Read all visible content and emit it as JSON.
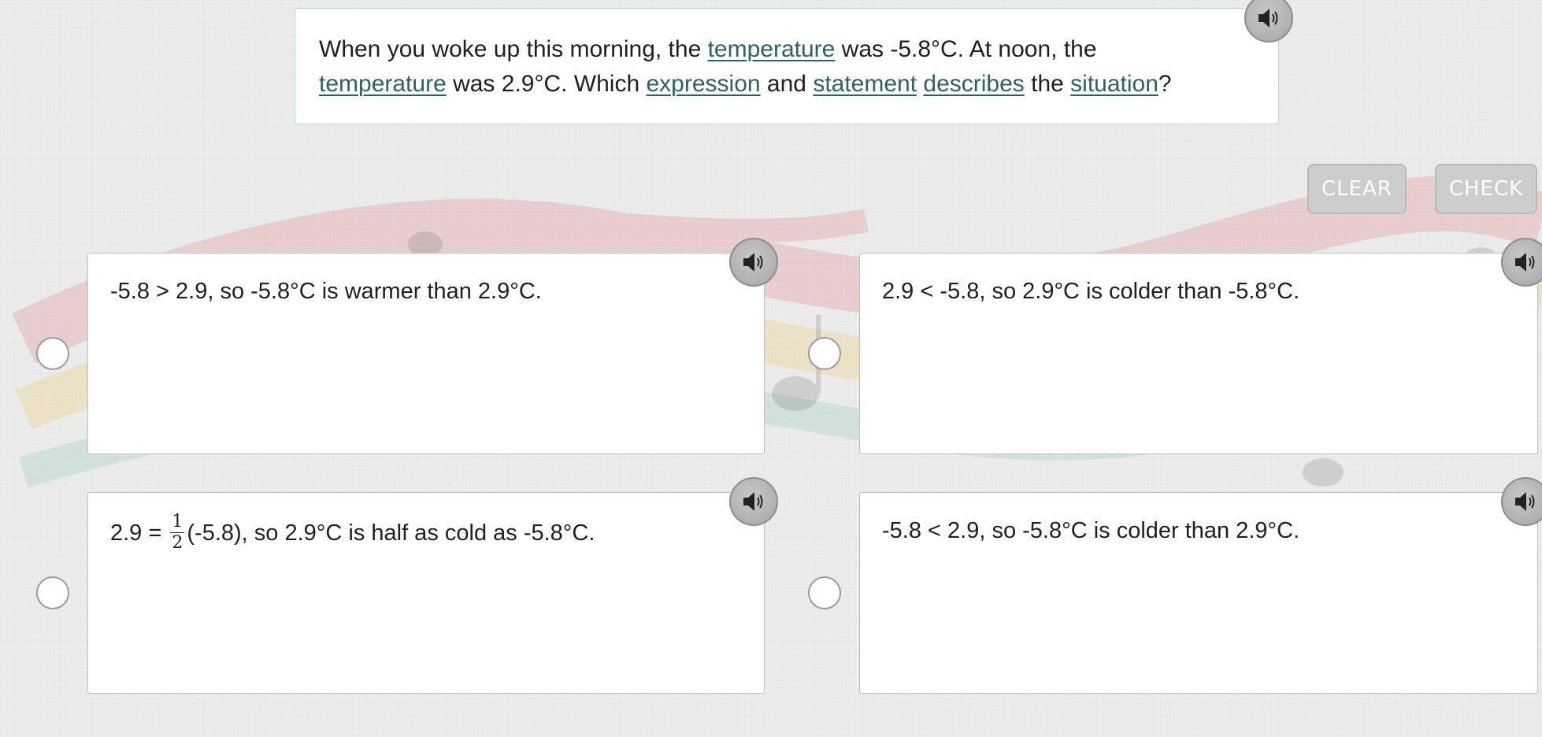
{
  "question": {
    "p1": "When you woke up this morning, the ",
    "w1": "temperature",
    "p2": " was -5.8°C. At noon, the",
    "w2": "temperature",
    "p3": " was 2.9°C. Which ",
    "w3": "expression",
    "p4": " and ",
    "w4": "statement",
    "p5": " ",
    "w5": "describes",
    "p6": " the ",
    "w6": "situation",
    "p7": "?"
  },
  "toolbar": {
    "clear_label": "CLEAR",
    "check_label": "CHECK"
  },
  "answers": [
    {
      "text": "-5.8 > 2.9, so -5.8°C is warmer than 2.9°C."
    },
    {
      "text": "2.9 < -5.8, so 2.9°C is colder than -5.8°C."
    },
    {
      "before": "2.9 = ",
      "frac_num": "1",
      "frac_den": "2",
      "after": "(-5.8), so 2.9°C is half as cold as -5.8°C."
    },
    {
      "text": "-5.8 < 2.9, so -5.8°C is colder than 2.9°C."
    }
  ],
  "icons": {
    "audio": "speaker-icon",
    "radio": "radio-button"
  },
  "colors": {
    "vocab_link": "#2e6066",
    "question_border": "#b5d6d6",
    "button_bg": "#cdcdcd",
    "button_text": "#ffffff",
    "audio_btn": "#b8b8b8"
  }
}
